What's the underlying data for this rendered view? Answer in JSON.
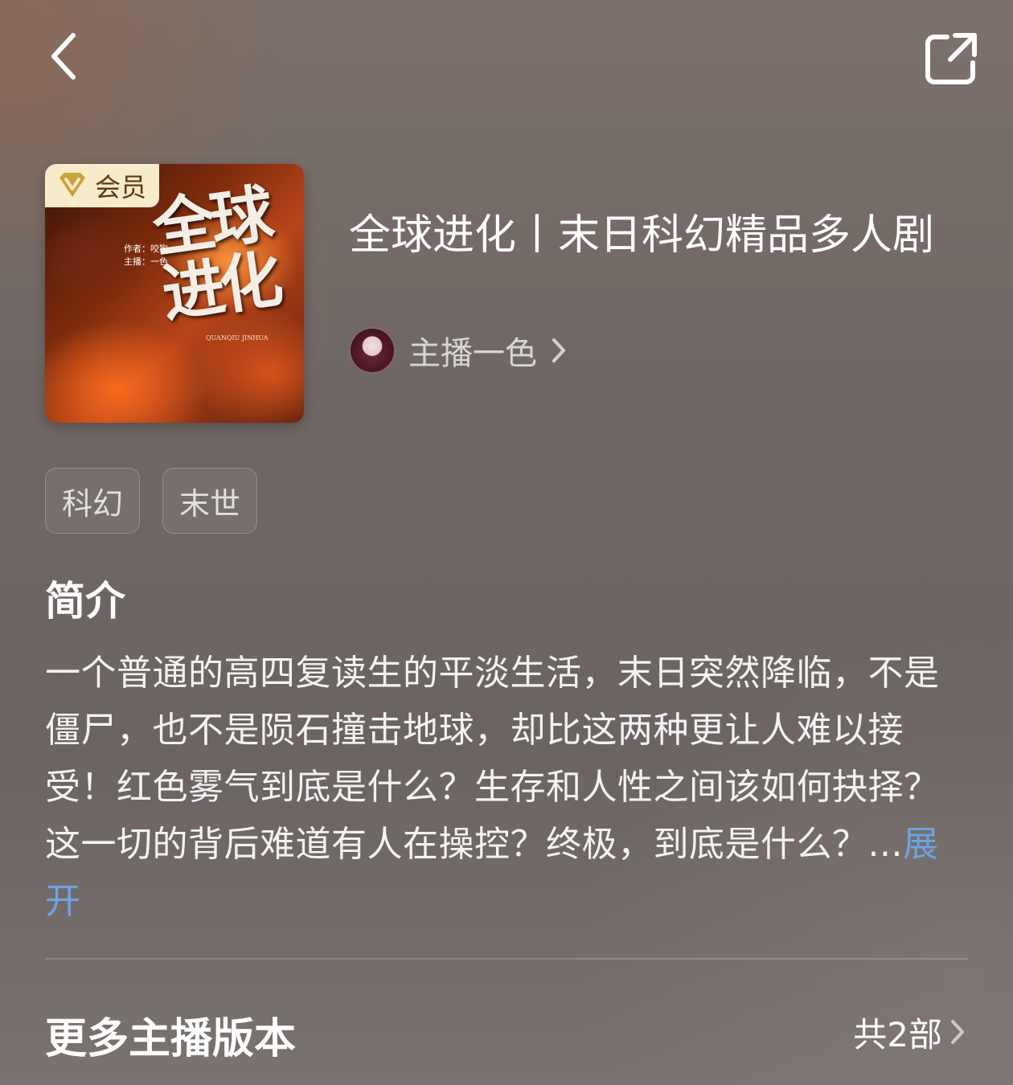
{
  "nav": {
    "back_icon": "chevron-left-icon",
    "share_icon": "share-external-icon"
  },
  "cover": {
    "badge_label": "会员",
    "badge_icon": "vip-v-icon",
    "cover_title_art": "全球进化",
    "cover_author_line": "作者：咬狗",
    "cover_anchor_line": "主播：一色",
    "cover_pinyin": "QUANQIU JINHUA"
  },
  "book": {
    "title": "全球进化丨末日科幻精品多人剧",
    "anchor_label": "主播一色"
  },
  "tags": [
    {
      "label": "科幻"
    },
    {
      "label": "末世"
    }
  ],
  "intro": {
    "heading": "简介",
    "text": "一个普通的高四复读生的平淡生活，末日突然降临，不是僵尸，也不是陨石撞击地球，却比这两种更让人难以接受！红色雾气到底是什么？生存和人性之间该如何抉择？这一切的背后难道有人在操控？终极，到底是什么？...",
    "expand_label": "展开"
  },
  "more_versions": {
    "heading": "更多主播版本",
    "count_label": "共2部"
  },
  "colors": {
    "accent_link": "#6ea3e6",
    "vip_badge_bg": "#f7ebc9",
    "vip_icon": "#c9a23a"
  }
}
